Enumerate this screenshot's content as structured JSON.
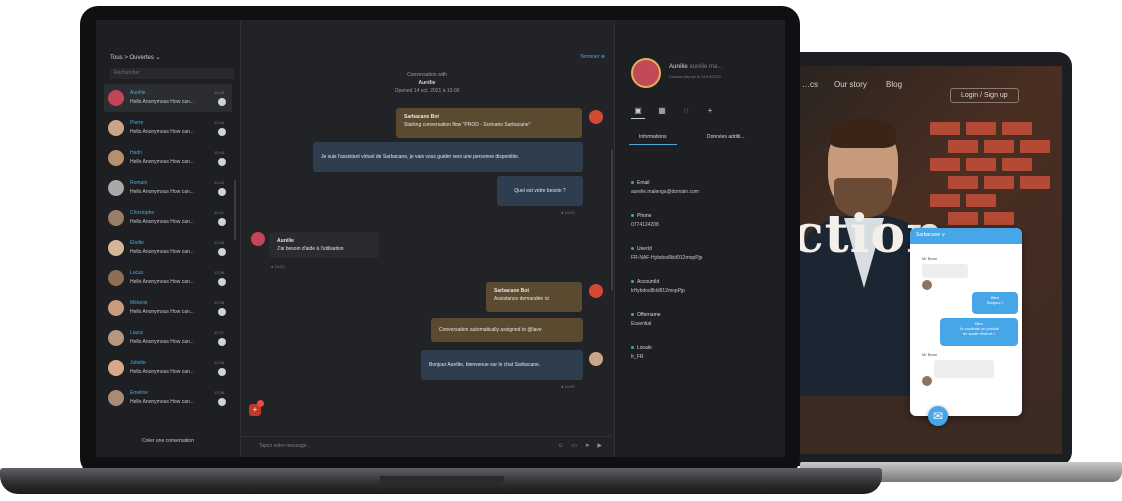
{
  "back_site": {
    "nav": [
      "…cs",
      "Our story",
      "Blog"
    ],
    "signup": "Login / Sign up",
    "hero_text": "ction",
    "widget": {
      "header": "Sarbacane ∨",
      "bot1_name": "Mr Bean",
      "user1": "Bien\nBonjour !",
      "user2": "Bien\nJe voudrais un produit\nde santé réservé !",
      "bot2_name": "Mr Bean",
      "fab": "✉"
    }
  },
  "app": {
    "breadcrumb": "Tous > Ouvertes ⌄",
    "search_placeholder": "Rechercher",
    "create_button": "Créer une conversation",
    "conversations": [
      {
        "name": "Aurélie",
        "message": "Hello Anonymous How can...",
        "time": "12:45",
        "active": true,
        "color": "#c2455a"
      },
      {
        "name": "Pierre",
        "message": "Hello Anonymous How can...",
        "time": "12:44",
        "active": false,
        "color": "#c9a58a"
      },
      {
        "name": "Hadri",
        "message": "Hello Anonymous How can...",
        "time": "12:43",
        "active": false,
        "color": "#b88f6c"
      },
      {
        "name": "Romain",
        "message": "Hello Anonymous How can...",
        "time": "12:42",
        "active": false,
        "color": "#a8a8a8"
      },
      {
        "name": "Christophe",
        "message": "Hello Anonymous How can...",
        "time": "12:41",
        "active": false,
        "color": "#9a7d66"
      },
      {
        "name": "Elodie",
        "message": "Hello Anonymous How can...",
        "time": "12:40",
        "active": false,
        "color": "#d4b79a"
      },
      {
        "name": "Lucas",
        "message": "Hello Anonymous How can...",
        "time": "12:39",
        "active": false,
        "color": "#8e6e55"
      },
      {
        "name": "Mélanie",
        "message": "Hello Anonymous How can...",
        "time": "12:38",
        "active": false,
        "color": "#c79b7e"
      },
      {
        "name": "Laura",
        "message": "Hello Anonymous How can...",
        "time": "12:37",
        "active": false,
        "color": "#b5967f"
      },
      {
        "name": "Juliette",
        "message": "Hello Anonymous How can...",
        "time": "12:36",
        "active": false,
        "color": "#d6a88b"
      },
      {
        "name": "Emeline",
        "message": "Hello Anonymous How can...",
        "time": "12:35",
        "active": false,
        "color": "#a88b75"
      }
    ],
    "chat": {
      "header_label": "Conversation with",
      "header_name": "Aurélie",
      "header_date": "Opened 14 oct. 2021 à 10:00",
      "top_right_label": "Terminer ⊗",
      "bot_title": "Sarbacane Bot",
      "bot_flow": "Starting conversation flow \"PROD - Scénario Sarbacane\"",
      "msg_assistant": "Je suis l'assistant virtuel de Sarbacane, je vais vous guider vers une personne disponible.",
      "msg_question": "Quel est votre besoin ?",
      "meta_1": "● 10:02",
      "user_name": "Aurélie",
      "user_msg": "J'ai besoin d'aide à l'utilisation",
      "meta_2": "● 10:02",
      "bot2_title": "Sarbacane Bot",
      "bot2_msg": "Assistance demandée ici",
      "assigned": "Conversation automatically assigned to @lave",
      "welcome": "Bonjour Aurélie, bienvenue sur le chat Sarbacane.",
      "meta_3": "● 10:05",
      "input_placeholder": "Tapez votre message...",
      "input_icons": "☺ ▭ ➤ ▶"
    },
    "profile": {
      "name": "Aurélie",
      "name_suffix": "aurelie.ma...",
      "subtitle": "Contact depuis le 14/10/2021",
      "tabs": [
        "Informations",
        "Données additi..."
      ],
      "fields": [
        {
          "label": "Email",
          "value": "aurelie.malenga@domain.com"
        },
        {
          "label": "Phone",
          "value": "0774124208"
        },
        {
          "label": "UserId",
          "value": "FR-NAF-Hybdos8kld912mopPjp"
        },
        {
          "label": "AccountId",
          "value": "kHybdos8kld912mopPjp"
        },
        {
          "label": "Offername",
          "value": "Essential"
        },
        {
          "label": "Locale",
          "value": "fr_FR"
        }
      ]
    }
  }
}
